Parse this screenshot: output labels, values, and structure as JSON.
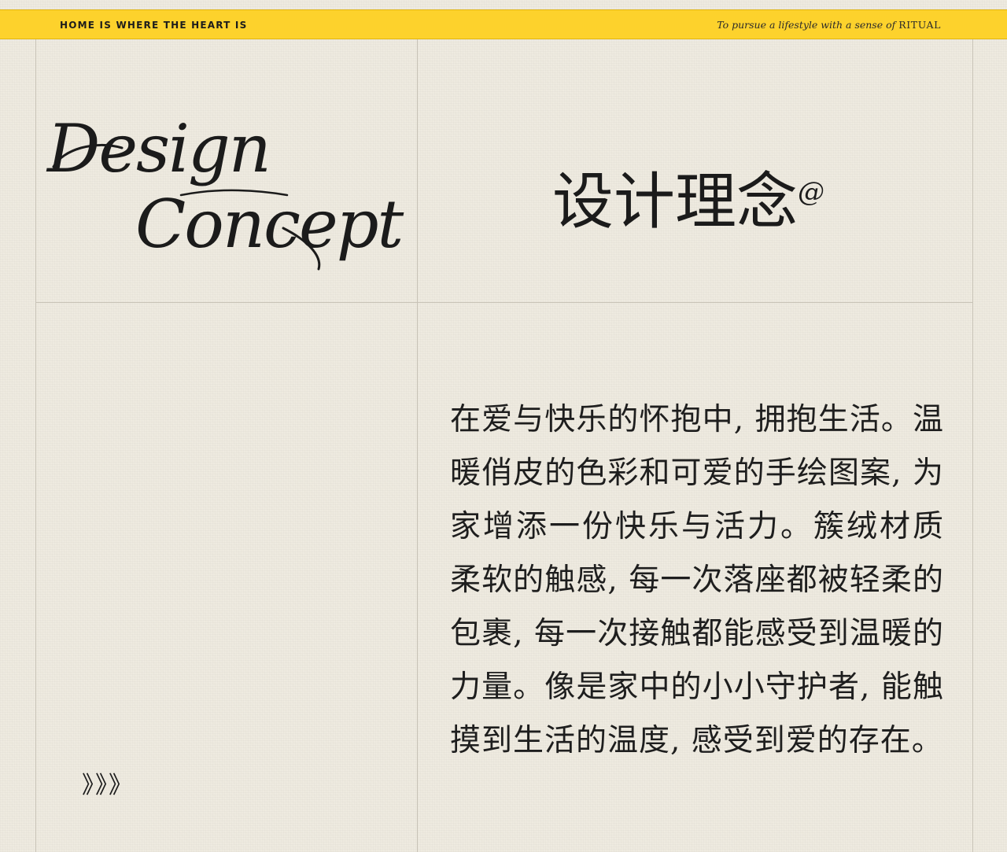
{
  "banner": {
    "left_text": "HOME IS WHERE THE HEART IS",
    "right_text_italic": "To pursue a lifestyle with a sense of",
    "right_text_caps": "RITUAL",
    "color": "#fdd22c"
  },
  "heading": {
    "script_line1": "Design",
    "script_line2": "Concept",
    "chinese_title": "设计理念",
    "title_mark": "@"
  },
  "body": {
    "paragraph": "在爱与快乐的怀抱中, 拥抱生活。温暖俏皮的色彩和可爱的手绘图案, 为家增添一份快乐与活力。簇绒材质柔软的触感, 每一次落座都被轻柔的包裹, 每一次接触都能感受到温暖的力量。像是家中的小小守护者, 能触摸到生活的温度, 感受到爱的存在。"
  },
  "decor": {
    "arrows": "》》》"
  },
  "colors": {
    "background": "#eeeadf",
    "grid_line": "#c8c3b7",
    "text": "#1b1b1b"
  }
}
